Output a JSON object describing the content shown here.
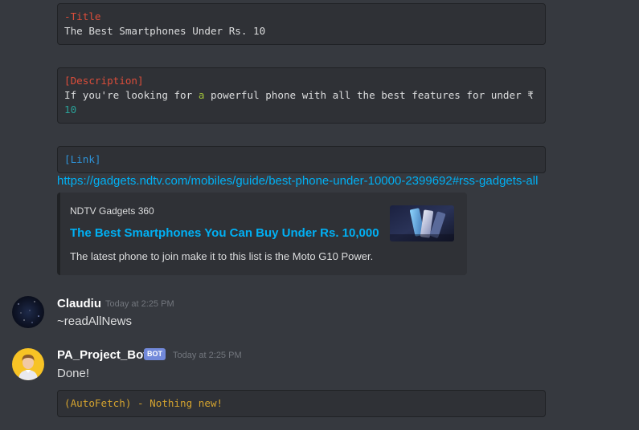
{
  "blocks": {
    "title_label": "-Title",
    "title_text": "The Best Smartphones Under Rs. 10",
    "desc_label": "[Description]",
    "desc_part1": "If you're looking for ",
    "desc_a": "a",
    "desc_part2": " powerful phone with all the best features for under ₹",
    "desc_num": "10",
    "link_label": "[Link]"
  },
  "link": {
    "url": "https://gadgets.ndtv.com/mobiles/guide/best-phone-under-10000-2399692#rss-gadgets-all"
  },
  "embed": {
    "provider": "NDTV Gadgets 360",
    "title": "The Best Smartphones You Can Buy Under Rs. 10,000",
    "description": "The latest phone to join make it to this list is the Moto G10 Power."
  },
  "messages": [
    {
      "username": "Claudiu",
      "timestamp": "Today at 2:25 PM",
      "content": "~readAllNews"
    },
    {
      "username": "PA_Project_Bot",
      "bot_tag": "BOT",
      "timestamp": "Today at 2:25 PM",
      "content": "Done!",
      "code": "(AutoFetch) - Nothing new!"
    }
  ],
  "colors": {
    "background": "#36393f",
    "codeblock": "#2f3136",
    "link": "#00b0f4",
    "bot_tag": "#7289da"
  }
}
